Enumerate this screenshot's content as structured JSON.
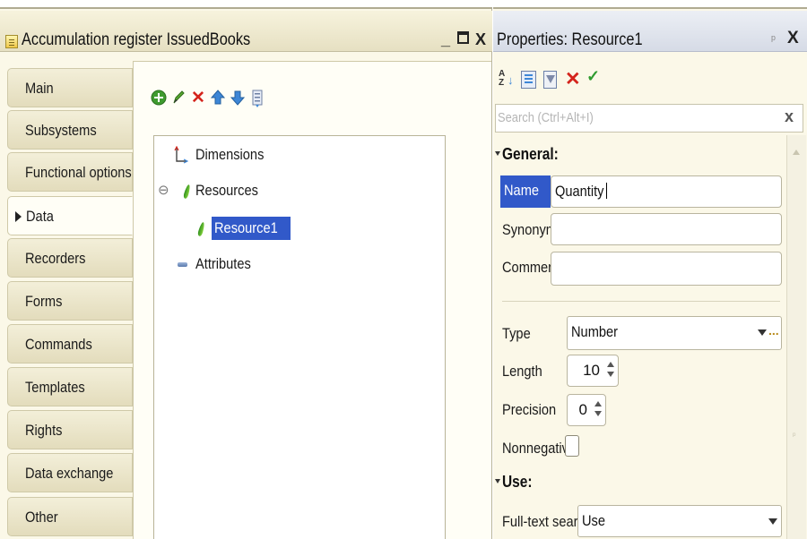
{
  "editor": {
    "title": "Accumulation register IssuedBooks",
    "window_controls": {
      "minimize": "_",
      "maximize": "☐",
      "close": "X"
    },
    "nav_tabs": [
      {
        "label": "Main",
        "active": false
      },
      {
        "label": "Subsystems",
        "active": false
      },
      {
        "label": "Functional options",
        "active": false
      },
      {
        "label": "Data",
        "active": true
      },
      {
        "label": "Recorders",
        "active": false
      },
      {
        "label": "Forms",
        "active": false
      },
      {
        "label": "Commands",
        "active": false
      },
      {
        "label": "Templates",
        "active": false
      },
      {
        "label": "Rights",
        "active": false
      },
      {
        "label": "Data exchange",
        "active": false
      },
      {
        "label": "Other",
        "active": false
      }
    ],
    "toolbar_icons": [
      "add-icon",
      "edit-pencil-icon",
      "delete-icon",
      "move-up-icon",
      "move-down-icon",
      "sort-list-icon"
    ],
    "tree": {
      "dimensions": "Dimensions",
      "resources": "Resources",
      "resource_child": "Resource1",
      "attributes": "Attributes",
      "collapse_glyph": "⊖"
    }
  },
  "properties": {
    "title": "Properties: Resource1",
    "pin_glyph": "ᵖ",
    "close_glyph": "X",
    "search_placeholder": "Search (Ctrl+Alt+I)",
    "search_clear": "x",
    "section_general": "General:",
    "name_label": "Name",
    "name_value": "Quantity",
    "synonym_label": "Synonym",
    "synonym_value": "",
    "comment_label": "Comment",
    "comment_value": "",
    "type_label": "Type",
    "type_value": "Number",
    "type_more": "...",
    "length_label": "Length",
    "length_value": "10",
    "precision_label": "Precision",
    "precision_value": "0",
    "nonnegative_label": "Nonnegative",
    "nonnegative_checked": false,
    "section_use": "Use:",
    "fulltext_label": "Full-text search",
    "fulltext_value": "Use"
  },
  "colors": {
    "selection": "#3159c9",
    "panel_bg": "#fbf8e8",
    "add_icon": "#3f9b2f",
    "delete_icon": "#d4241c",
    "arrow_icon": "#3d86d6"
  }
}
